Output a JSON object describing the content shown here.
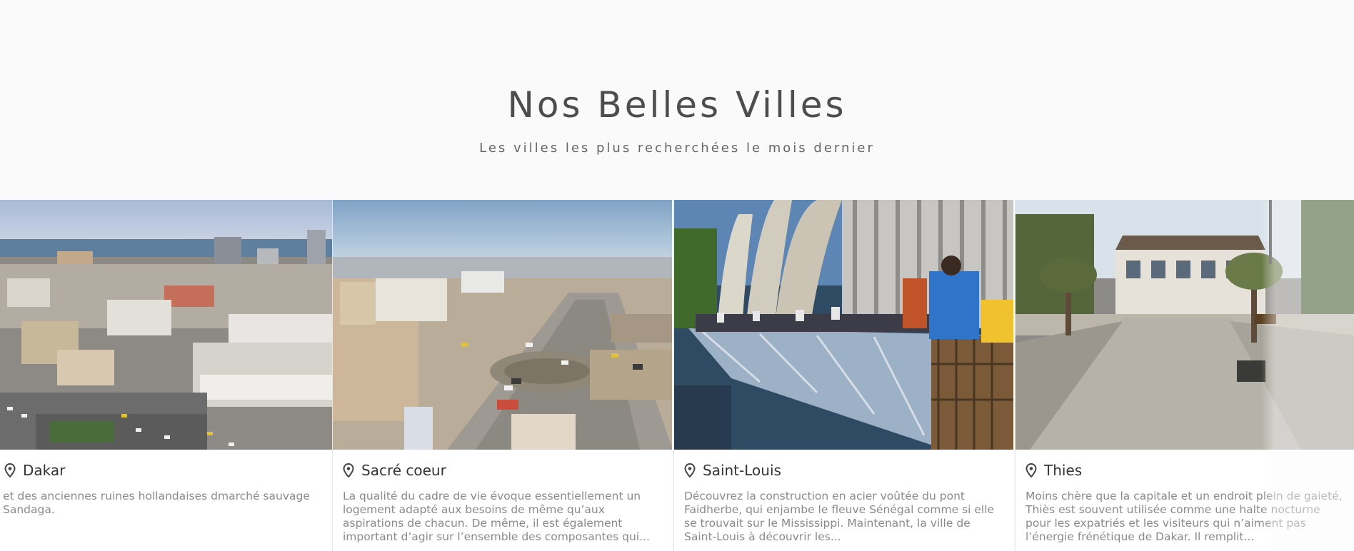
{
  "section": {
    "title": "Nos Belles Villes",
    "subtitle": "Les villes les plus recherchées le mois dernier"
  },
  "cities": [
    {
      "name": "Dakar",
      "icon": "map-pin-icon",
      "image": "dakar-aerial-photo",
      "description": "et des anciennes ruines hollandaises dmarché sauvage Sandaga."
    },
    {
      "name": "Sacré coeur",
      "icon": "map-pin-icon",
      "image": "sacre-coeur-roundabout-photo",
      "description": "La qualité du cadre de vie évoque essentiellement un logement adapté aux besoins de même qu’aux aspirations de chacun. De même, il est également important d’agir sur l’ensemble des composantes qui..."
    },
    {
      "name": "Saint-Louis",
      "icon": "map-pin-icon",
      "image": "faidherbe-bridge-photo",
      "description": "Découvrez la construction en acier voûtée du pont Faidherbe, qui enjambe le fleuve Sénégal comme si elle se trouvait sur le Mississippi. Maintenant, la ville de Saint-Louis à découvrir les..."
    },
    {
      "name": "Thies",
      "icon": "map-pin-icon",
      "image": "thies-colonial-building-photo",
      "description": "Moins chère que la capitale et un endroit plein de gaieté, Thiès est souvent utilisée comme une halte nocturne pour les expatriés et les visiteurs qui n’aiment pas l’énergie frénétique de Dakar. Il remplit..."
    }
  ]
}
